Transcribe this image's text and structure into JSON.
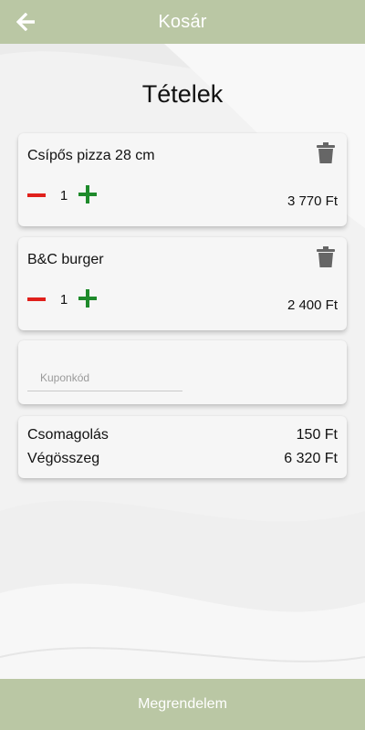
{
  "header": {
    "title": "Kosár",
    "back_icon": "arrow-left-icon"
  },
  "page_title": "Tételek",
  "items": [
    {
      "name": "Csípős pizza 28 cm",
      "quantity": "1",
      "price": "3 770 Ft"
    },
    {
      "name": "B&C burger",
      "quantity": "1",
      "price": "2 400 Ft"
    }
  ],
  "coupon": {
    "placeholder": "Kuponkód",
    "value": ""
  },
  "summary": {
    "packaging_label": "Csomagolás",
    "packaging_value": "150 Ft",
    "total_label": "Végösszeg",
    "total_value": "6 320 Ft"
  },
  "footer": {
    "order_label": "Megrendelem"
  },
  "colors": {
    "bar": "#bac7a4",
    "minus": "#e0201b",
    "plus": "#1e8a2b",
    "trash": "#666666"
  }
}
